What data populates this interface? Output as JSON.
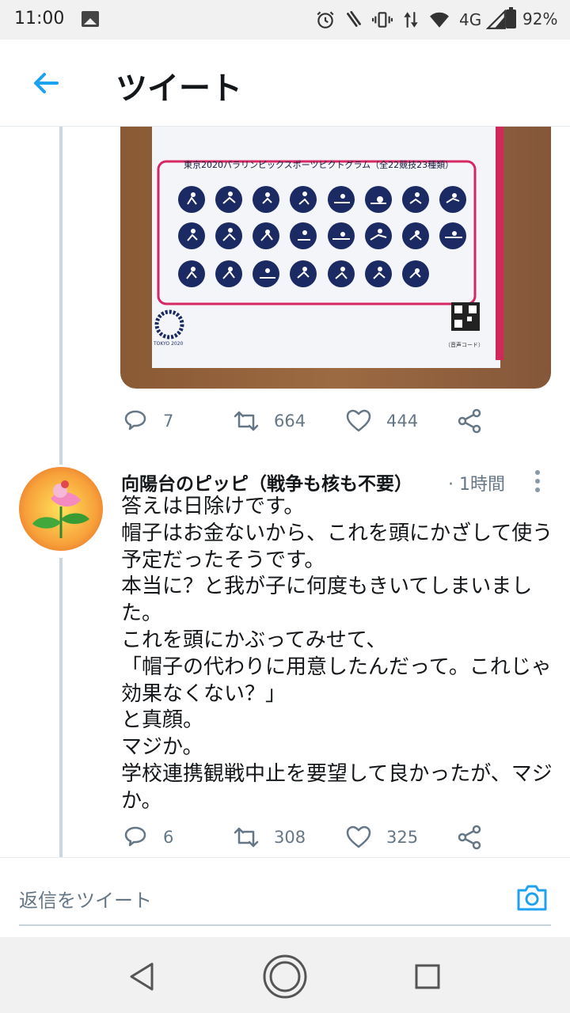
{
  "status_bar": {
    "time": "11:00",
    "network": "4G",
    "battery": "92%",
    "icons": [
      "image-icon",
      "alarm-icon",
      "nfc-icon",
      "vibrate-icon",
      "data-icon",
      "wifi-icon",
      "signal-icon",
      "battery-icon"
    ]
  },
  "header": {
    "title": "ツイート",
    "back_icon": "arrow-left-icon"
  },
  "colors": {
    "accent": "#1da1f2",
    "text": "#14171a",
    "secondary": "#657786",
    "thread": "#ccd6dd"
  },
  "first_tweet": {
    "media": {
      "chart_title": "東京2020パラリンピックスポーツピクトグラム（全22競技23種類）",
      "logo_text": "TOKYO 2020",
      "qr_caption": "（音声コード）"
    },
    "actions": {
      "reply_count": "7",
      "retweet_count": "664",
      "like_count": "444"
    }
  },
  "reply_tweet": {
    "author": "向陽台のピッピ（戦争も核も不要）",
    "time": "· 1時間",
    "lines": [
      "答えは日除けです。",
      "帽子はお金ないから、これを頭にかざして使う",
      "予定だったそうです。",
      "本当に？と我が子に何度もきいてしまいまし",
      "た。",
      "これを頭にかぶってみせて、",
      "「帽子の代わりに用意したんだって。これじゃ",
      "効果なくない？」",
      "と真顔。",
      "マジか。",
      "学校連携観戦中止を要望して良かったが、マジ",
      "か。"
    ],
    "actions": {
      "reply_count": "6",
      "retweet_count": "308",
      "like_count": "325"
    }
  },
  "reply_bar": {
    "placeholder": "返信をツイート",
    "camera_icon": "camera-icon"
  },
  "nav_bar": {
    "buttons": [
      "back-triangle-icon",
      "home-circle-icon",
      "recents-square-icon"
    ]
  }
}
